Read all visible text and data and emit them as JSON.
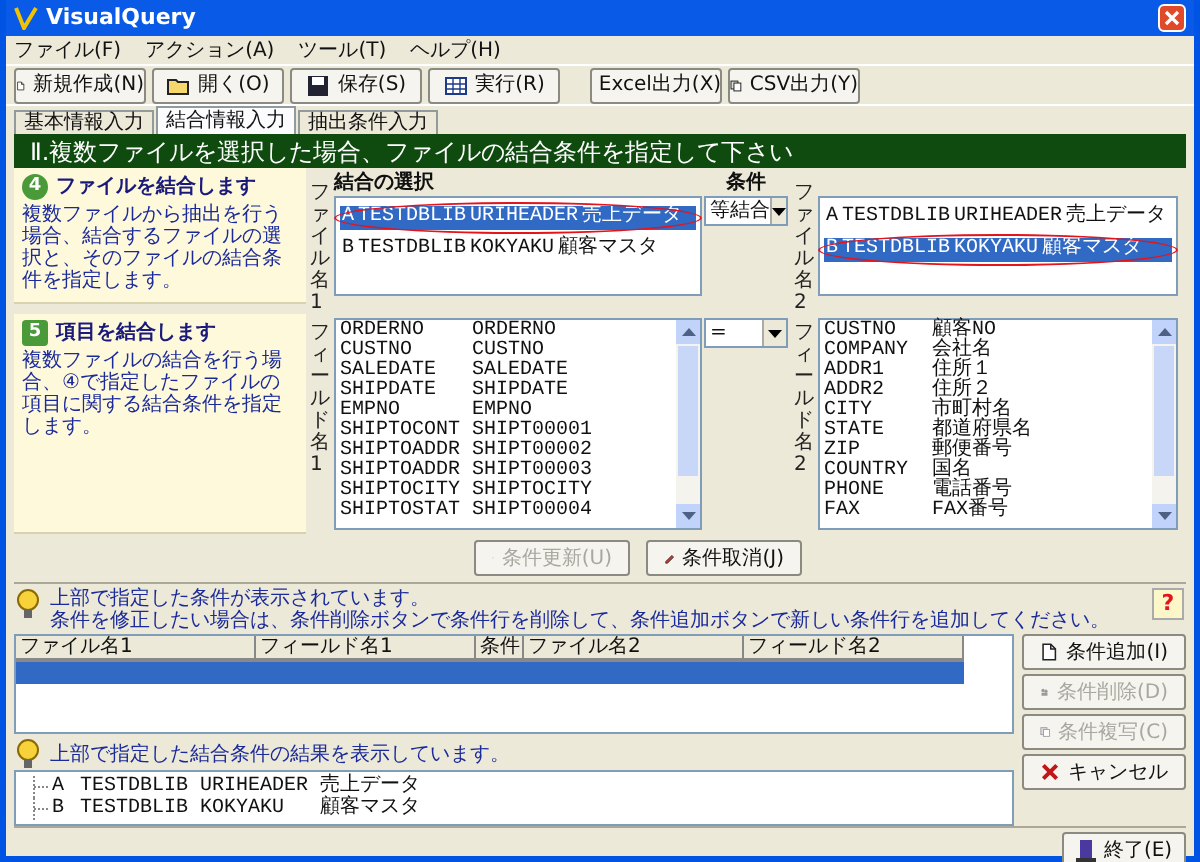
{
  "window": {
    "title": "VisualQuery"
  },
  "menu": [
    "ファイル(F)",
    "アクション(A)",
    "ツール(T)",
    "ヘルプ(H)"
  ],
  "toolbar": [
    "新規作成(N)",
    "開く(O)",
    "保存(S)",
    "実行(R)",
    "Excel出力(X)",
    "CSV出力(Y)"
  ],
  "tabs": [
    {
      "label": "基本情報入力",
      "selected": false
    },
    {
      "label": "結合情報入力",
      "selected": true
    },
    {
      "label": "抽出条件入力",
      "selected": false
    }
  ],
  "heading": "Ⅱ.複数ファイルを選択した場合、ファイルの結合条件を指定して下さい",
  "steps": [
    {
      "number": "4",
      "title": "ファイルを結合します",
      "text": "複数ファイルから抽出を行う場合、結合するファイルの選択と、そのファイルの結合条件を指定します。"
    },
    {
      "number": "5",
      "title": "項目を結合します",
      "text": "複数ファイルの結合を行う場合、④で指定したファイルの項目に関する結合条件を指定します。"
    }
  ],
  "join": {
    "file_list_label": "結合の選択",
    "condition_label": "条件",
    "file1_label": "ファイル名1",
    "field1_label": "フィールド名1",
    "file2_label": "ファイル名2",
    "field2_label": "フィールド名2",
    "join_type": "等結合",
    "operator": "=",
    "files1": [
      {
        "code": "A",
        "library": "TESTDBLIB",
        "table": "URIHEADER",
        "name": "売上データ",
        "selected": true,
        "circled": true
      },
      {
        "code": "B",
        "library": "TESTDBLIB",
        "table": "KOKYAKU",
        "name": "顧客マスタ",
        "selected": false,
        "circled": false
      }
    ],
    "fields1": [
      [
        "ORDERNO",
        "ORDERNO"
      ],
      [
        "CUSTNO",
        "CUSTNO"
      ],
      [
        "SALEDATE",
        "SALEDATE"
      ],
      [
        "SHIPDATE",
        "SHIPDATE"
      ],
      [
        "EMPNO",
        "EMPNO"
      ],
      [
        "SHIPTOCONT",
        "SHIPT00001"
      ],
      [
        "SHIPTOADDR",
        "SHIPT00002"
      ],
      [
        "SHIPTOADDR",
        "SHIPT00003"
      ],
      [
        "SHIPTOCITY",
        "SHIPTOCITY"
      ],
      [
        "SHIPTOSTAT",
        "SHIPT00004"
      ]
    ],
    "files2": [
      {
        "code": "A",
        "library": "TESTDBLIB",
        "table": "URIHEADER",
        "name": "売上データ",
        "selected": false,
        "circled": false
      },
      {
        "code": "B",
        "library": "TESTDBLIB",
        "table": "KOKYAKU",
        "name": "顧客マスタ",
        "selected": true,
        "circled": true
      }
    ],
    "fields2": [
      [
        "CUSTNO",
        "顧客NO"
      ],
      [
        "COMPANY",
        "会社名"
      ],
      [
        "ADDR1",
        "住所１"
      ],
      [
        "ADDR2",
        "住所２"
      ],
      [
        "CITY",
        "市町村名"
      ],
      [
        "STATE",
        "都道府県名"
      ],
      [
        "ZIP",
        "郵便番号"
      ],
      [
        "COUNTRY",
        "国名"
      ],
      [
        "PHONE",
        "電話番号"
      ],
      [
        "FAX",
        "FAX番号"
      ]
    ]
  },
  "action_buttons": [
    {
      "label": "条件更新(U)",
      "disabled": true
    },
    {
      "label": "条件取消(J)",
      "disabled": false
    }
  ],
  "conditions": {
    "info": [
      "上部で指定した条件が表示されています。",
      "条件を修正したい場合は、条件削除ボタンで条件行を削除して、条件追加ボタンで新しい条件行を追加してください。"
    ],
    "help": "?",
    "columns": [
      "ファイル名1",
      "フィールド名1",
      "条件",
      "ファイル名2",
      "フィールド名2"
    ],
    "rows": [
      {
        "selected": true
      }
    ]
  },
  "side_buttons": [
    {
      "label": "条件追加(I)",
      "disabled": false
    },
    {
      "label": "条件削除(D)",
      "disabled": true
    },
    {
      "label": "条件複写(C)",
      "disabled": true
    },
    {
      "label": "キャンセル",
      "disabled": false
    }
  ],
  "result": {
    "info": "上部で指定した結合条件の結果を表示しています。",
    "items": [
      {
        "code": "A",
        "library": "TESTDBLIB",
        "table": "URIHEADER",
        "name": "売上データ"
      },
      {
        "code": "B",
        "library": "TESTDBLIB",
        "table": "KOKYAKU",
        "name": "顧客マスタ"
      }
    ]
  },
  "exit_button": {
    "label": "終了(E)"
  }
}
